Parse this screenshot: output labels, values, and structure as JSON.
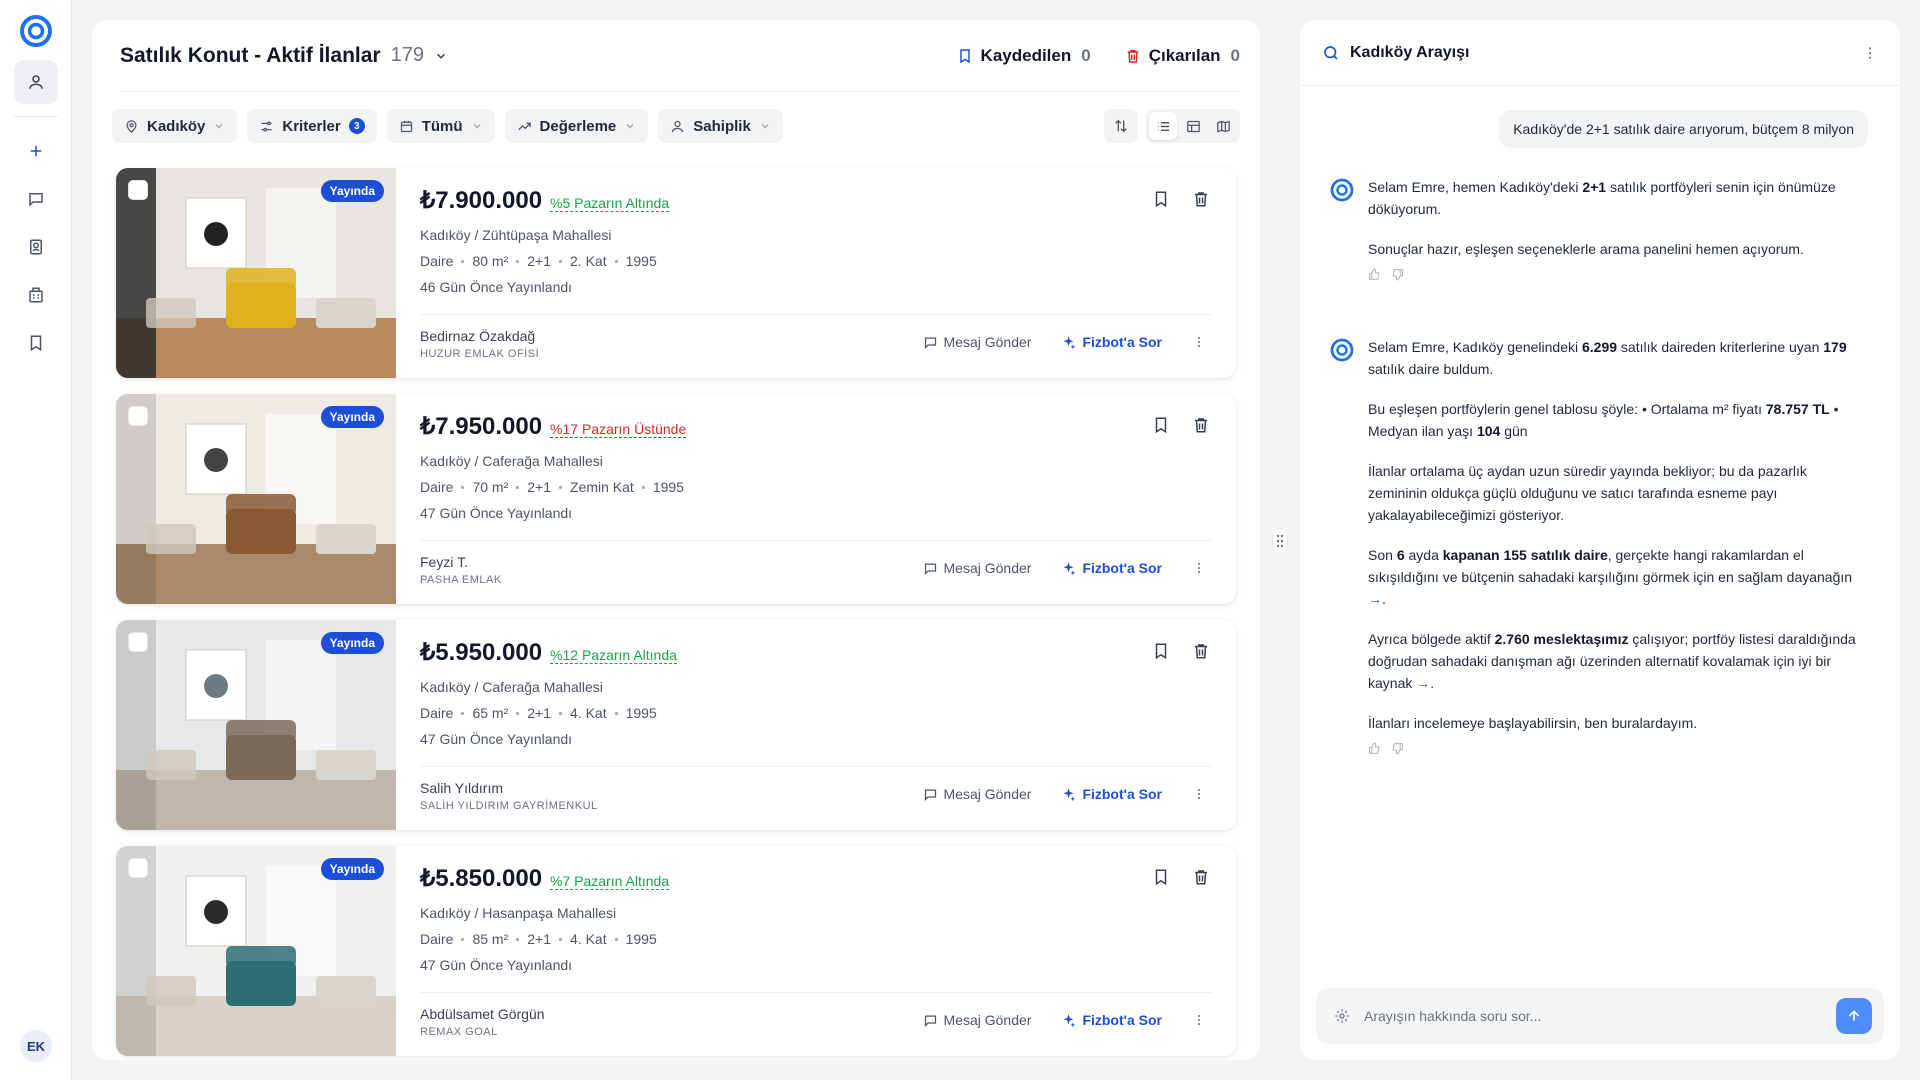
{
  "nav": {
    "items": [
      "profile-icon",
      "plus-icon",
      "chat-icon",
      "contacts-icon",
      "building-icon",
      "bookmark-icon"
    ],
    "avatar_initials": "EK"
  },
  "listings": {
    "title": "Satılık Konut - Aktif İlanlar",
    "count": "179",
    "saved_label": "Kaydedilen",
    "saved_count": "0",
    "removed_label": "Çıkarılan",
    "removed_count": "0",
    "filters": {
      "location": "Kadıköy",
      "criteria": "Kriterler",
      "criteria_badge": "3",
      "date": "Tümü",
      "valuation": "Değerleme",
      "ownership": "Sahiplik"
    },
    "status_badge": "Yayında",
    "message_label": "Mesaj Gönder",
    "ask_label": "Fizbot'a Sor",
    "cards": [
      {
        "price": "₺7.900.000",
        "tag": "%5 Pazarın Altında",
        "tag_tone": "green",
        "location": "Kadıköy / Zühtüpaşa Mahallesi",
        "type": "Daire",
        "area": "80 m²",
        "rooms": "2+1",
        "floor": "2. Kat",
        "year": "1995",
        "date": "46 Gün Önce Yayınlandı",
        "agent": "Bedirnaz Özakdağ",
        "office": "HUZUR EMLAK OFİSİ"
      },
      {
        "price": "₺7.950.000",
        "tag": "%17 Pazarın Üstünde",
        "tag_tone": "red",
        "location": "Kadıköy / Caferağa Mahallesi",
        "type": "Daire",
        "area": "70 m²",
        "rooms": "2+1",
        "floor": "Zemin Kat",
        "year": "1995",
        "date": "47 Gün Önce Yayınlandı",
        "agent": "Feyzi T.",
        "office": "PASHA EMLAK"
      },
      {
        "price": "₺5.950.000",
        "tag": "%12 Pazarın Altında",
        "tag_tone": "green",
        "location": "Kadıköy / Caferağa Mahallesi",
        "type": "Daire",
        "area": "65 m²",
        "rooms": "2+1",
        "floor": "4. Kat",
        "year": "1995",
        "date": "47 Gün Önce Yayınlandı",
        "agent": "Salih Yıldırım",
        "office": "SALİH YILDIRIM GAYRİMENKUL"
      },
      {
        "price": "₺5.850.000",
        "tag": "%7 Pazarın Altında",
        "tag_tone": "green",
        "location": "Kadıköy / Hasanpaşa Mahallesi",
        "type": "Daire",
        "area": "85 m²",
        "rooms": "2+1",
        "floor": "4. Kat",
        "year": "1995",
        "date": "47 Gün Önce Yayınlandı",
        "agent": "Abdülsamet Görgün",
        "office": "REMAX GOAL"
      }
    ]
  },
  "chat": {
    "title": "Kadıköy Arayışı",
    "user_message": "Kadıköy'de 2+1 satılık daire arıyorum, bütçem 8 milyon",
    "m1": {
      "p1_a": "Selam Emre, hemen Kadıköy'deki ",
      "p1_b": "2+1",
      "p1_c": " satılık portföyleri senin için önümüze döküyorum.",
      "p2": "Sonuçlar hazır, eşleşen seçeneklerle arama panelini hemen açıyorum."
    },
    "m2": {
      "p1_a": "Selam Emre, Kadıköy genelindeki ",
      "p1_b": "6.299",
      "p1_c": " satılık daireden kriterlerine uyan ",
      "p1_d": "179",
      "p1_e": " satılık daire buldum.",
      "p2_a": "Bu eşleşen portföylerin genel tablosu şöyle: • Ortalama m² fiyatı ",
      "p2_b": "78.757 TL",
      "p2_c": " • Medyan ilan yaşı ",
      "p2_d": "104",
      "p2_e": " gün",
      "p3": "İlanlar ortalama üç aydan uzun süredir yayında bekliyor; bu da pazarlık zemininin oldukça güçlü olduğunu ve satıcı tarafında esneme payı yakalayabileceğimizi gösteriyor.",
      "p4_a": "Son ",
      "p4_b": "6",
      "p4_c": " ayda ",
      "p4_d": "kapanan 155 satılık daire",
      "p4_e": ", gerçekte hangi rakamlardan el sıkışıldığını ve bütçenin sahadaki karşılığını görmek için en sağlam dayanağın",
      "p4_arrow": "→",
      "p4_f": ".",
      "p5_a": "Ayrıca bölgede aktif ",
      "p5_b": "2.760 meslektaşımız",
      "p5_c": " çalışıyor; portföy listesi daraldığında doğrudan sahadaki danışman ağı üzerinden alternatif kovalamak için iyi bir kaynak",
      "p5_arrow": "→",
      "p5_d": ".",
      "p6": "İlanları incelemeye başlayabilirsin, ben buralardayım."
    },
    "input_placeholder": "Arayışın hakkında soru sor..."
  },
  "colors": {
    "accent": "#1d4ed8",
    "green": "#16a34a",
    "red": "#dc2626",
    "send": "#4f8cf7"
  }
}
